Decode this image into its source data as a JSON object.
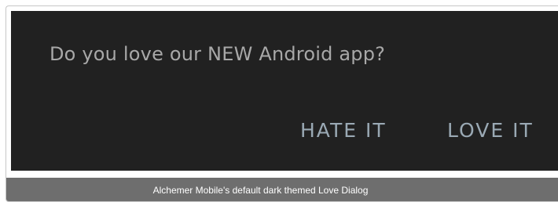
{
  "dialog": {
    "question": "Do you love our NEW Android app?",
    "buttons": {
      "hate_label": "HATE IT",
      "love_label": "LOVE IT"
    },
    "colors": {
      "background": "#212121",
      "text": "#a8a8a8",
      "button_text": "#9aa9b4"
    }
  },
  "caption": {
    "text": "Alchemer Mobile's default dark themed Love Dialog"
  }
}
